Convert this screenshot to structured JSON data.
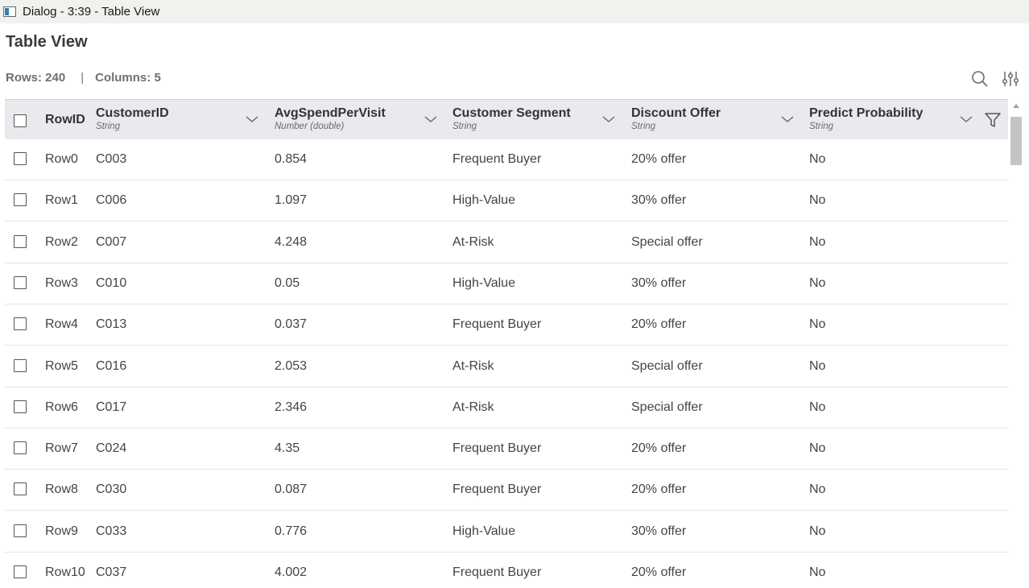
{
  "window": {
    "title": "Dialog - 3:39 - Table View",
    "icon": "window-icon"
  },
  "page": {
    "title": "Table View"
  },
  "stats": {
    "rows": "Rows: 240",
    "separator": "|",
    "columns": "Columns: 5"
  },
  "toolbar": {
    "search_icon": "search-icon",
    "settings_icon": "sliders-icon"
  },
  "table": {
    "rowid_header": "RowID",
    "columns": [
      {
        "name": "CustomerID",
        "type": "String"
      },
      {
        "name": "AvgSpendPerVisit",
        "type": "Number (double)"
      },
      {
        "name": "Customer Segment",
        "type": "String"
      },
      {
        "name": "Discount Offer",
        "type": "String"
      },
      {
        "name": "Predict Probability",
        "type": "String"
      }
    ],
    "rows": [
      [
        "Row0",
        "C003",
        "0.854",
        "Frequent Buyer",
        "20% offer",
        "No"
      ],
      [
        "Row1",
        "C006",
        "1.097",
        "High-Value",
        "30% offer",
        "No"
      ],
      [
        "Row2",
        "C007",
        "4.248",
        "At-Risk",
        "Special offer",
        "No"
      ],
      [
        "Row3",
        "C010",
        "0.05",
        "High-Value",
        "30% offer",
        "No"
      ],
      [
        "Row4",
        "C013",
        "0.037",
        "Frequent Buyer",
        "20% offer",
        "No"
      ],
      [
        "Row5",
        "C016",
        "2.053",
        "At-Risk",
        "Special offer",
        "No"
      ],
      [
        "Row6",
        "C017",
        "2.346",
        "At-Risk",
        "Special offer",
        "No"
      ],
      [
        "Row7",
        "C024",
        "4.35",
        "Frequent Buyer",
        "20% offer",
        "No"
      ],
      [
        "Row8",
        "C030",
        "0.087",
        "Frequent Buyer",
        "20% offer",
        "No"
      ],
      [
        "Row9",
        "C033",
        "0.776",
        "High-Value",
        "30% offer",
        "No"
      ],
      [
        "Row10",
        "C037",
        "4.002",
        "Frequent Buyer",
        "20% offer",
        "No"
      ]
    ]
  },
  "colors": {
    "header_bg": "#e8eaee",
    "titlebar_bg": "#f3f1ee",
    "row_border": "#e2e4e7"
  }
}
